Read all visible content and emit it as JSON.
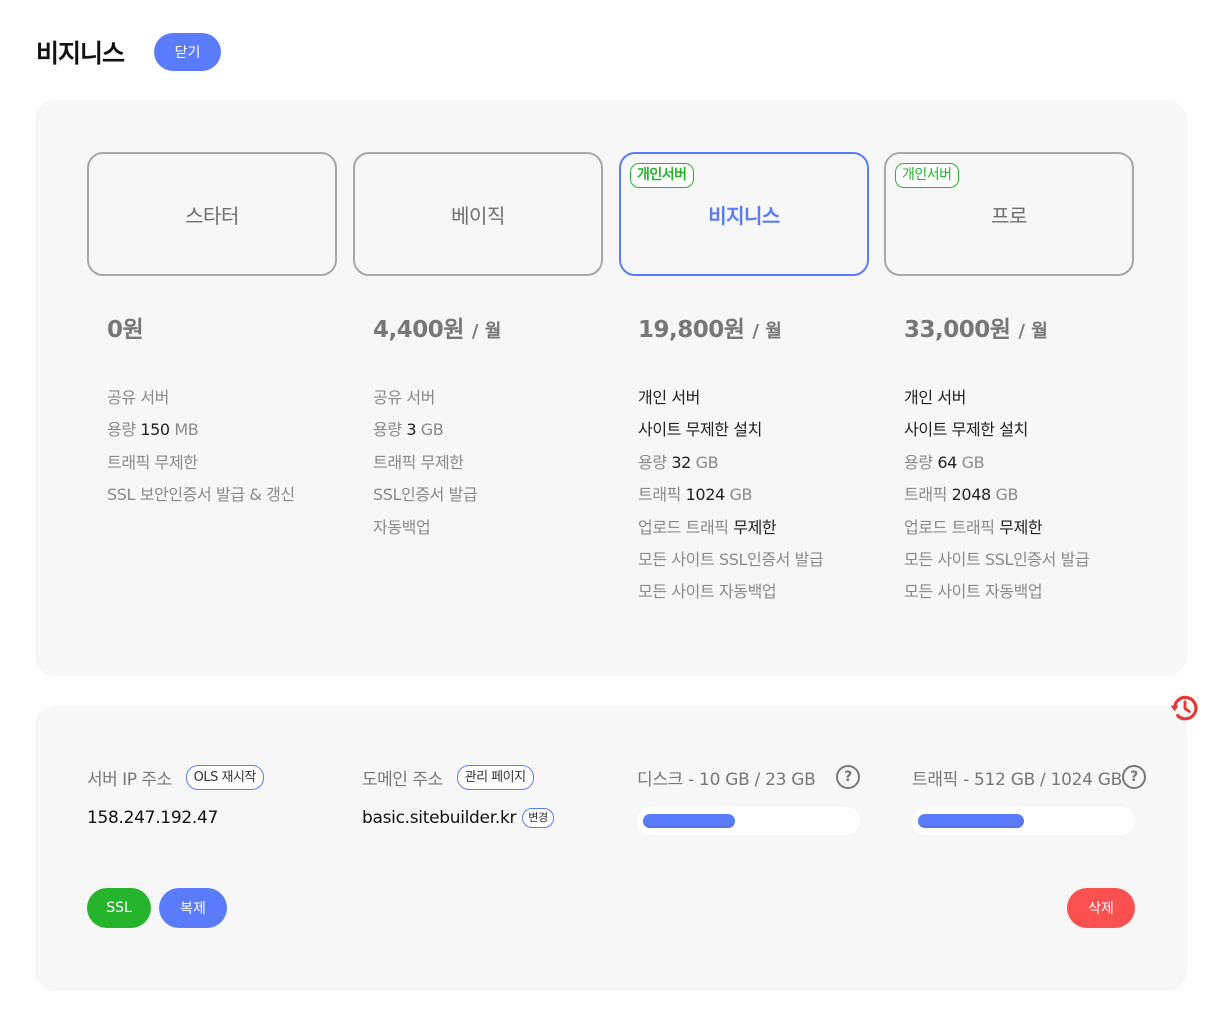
{
  "header": {
    "title": "비지니스",
    "close_label": "닫기"
  },
  "plans": [
    {
      "name": "스타터",
      "tag": "",
      "selected": false,
      "price": "0원",
      "unit": "",
      "features": [
        {
          "parts": [
            {
              "t": "공유 서버",
              "hl": false
            }
          ]
        },
        {
          "parts": [
            {
              "t": "용량 ",
              "hl": false
            },
            {
              "t": "150",
              "hl": true
            },
            {
              "t": " MB",
              "hl": false
            }
          ]
        },
        {
          "parts": [
            {
              "t": "트래픽 무제한",
              "hl": false
            }
          ]
        },
        {
          "parts": [
            {
              "t": "SSL 보안인증서 발급 & 갱신",
              "hl": false
            }
          ]
        }
      ]
    },
    {
      "name": "베이직",
      "tag": "",
      "selected": false,
      "price": "4,400원",
      "unit": "/ 월",
      "features": [
        {
          "parts": [
            {
              "t": "공유 서버",
              "hl": false
            }
          ]
        },
        {
          "parts": [
            {
              "t": "용량 ",
              "hl": false
            },
            {
              "t": "3",
              "hl": true
            },
            {
              "t": " GB",
              "hl": false
            }
          ]
        },
        {
          "parts": [
            {
              "t": "트래픽 무제한",
              "hl": false
            }
          ]
        },
        {
          "parts": [
            {
              "t": "SSL인증서 발급",
              "hl": false
            }
          ]
        },
        {
          "parts": [
            {
              "t": "자동백업",
              "hl": false
            }
          ]
        }
      ]
    },
    {
      "name": "비지니스",
      "tag": "개인서버",
      "selected": true,
      "price": "19,800원",
      "unit": "/ 월",
      "features": [
        {
          "parts": [
            {
              "t": "개인 서버",
              "hl": true
            }
          ]
        },
        {
          "parts": [
            {
              "t": "사이트 무제한 설치",
              "hl": true
            }
          ]
        },
        {
          "parts": [
            {
              "t": "용량 ",
              "hl": false
            },
            {
              "t": "32",
              "hl": true
            },
            {
              "t": " GB",
              "hl": false
            }
          ]
        },
        {
          "parts": [
            {
              "t": "트래픽 ",
              "hl": false
            },
            {
              "t": "1024",
              "hl": true
            },
            {
              "t": " GB",
              "hl": false
            }
          ]
        },
        {
          "parts": [
            {
              "t": "업로드 트래픽 ",
              "hl": false
            },
            {
              "t": "무제한",
              "hl": true
            }
          ]
        },
        {
          "parts": [
            {
              "t": "모든 사이트 SSL인증서 발급",
              "hl": false
            }
          ]
        },
        {
          "parts": [
            {
              "t": "모든 사이트 자동백업",
              "hl": false
            }
          ]
        }
      ]
    },
    {
      "name": "프로",
      "tag": "개인서버",
      "selected": false,
      "price": "33,000원",
      "unit": "/ 월",
      "features": [
        {
          "parts": [
            {
              "t": "개인 서버",
              "hl": true
            }
          ]
        },
        {
          "parts": [
            {
              "t": "사이트 무제한 설치",
              "hl": true
            }
          ]
        },
        {
          "parts": [
            {
              "t": "용량 ",
              "hl": false
            },
            {
              "t": "64",
              "hl": true
            },
            {
              "t": " GB",
              "hl": false
            }
          ]
        },
        {
          "parts": [
            {
              "t": "트래픽 ",
              "hl": false
            },
            {
              "t": "2048",
              "hl": true
            },
            {
              "t": " GB",
              "hl": false
            }
          ]
        },
        {
          "parts": [
            {
              "t": "업로드 트래픽 ",
              "hl": false
            },
            {
              "t": "무제한",
              "hl": true
            }
          ]
        },
        {
          "parts": [
            {
              "t": "모든 사이트 SSL인증서 발급",
              "hl": false
            }
          ]
        },
        {
          "parts": [
            {
              "t": "모든 사이트 자동백업",
              "hl": false
            }
          ]
        }
      ]
    }
  ],
  "server": {
    "ip_label": "서버 IP 주소",
    "ols_restart_label": "OLS 재시작",
    "ip_value": "158.247.192.47",
    "domain_label": "도메인 주소",
    "admin_page_label": "관리 페이지",
    "domain_value": "basic.sitebuilder.kr",
    "change_label": "변경",
    "disk_label": "디스크 - 10 GB / 23 GB",
    "disk_fraction": 0.4348,
    "traffic_label": "트래픽 - 512 GB / 1024 GB",
    "traffic_fraction": 0.5,
    "help_glyph": "?",
    "history_icon": "history-icon"
  },
  "actions": {
    "ssl_label": "SSL",
    "copy_label": "복제",
    "delete_label": "삭제"
  },
  "colors": {
    "accent": "#5b7cfa",
    "green": "#27b42d",
    "danger": "#fa5050",
    "history_red": "#e53935"
  }
}
